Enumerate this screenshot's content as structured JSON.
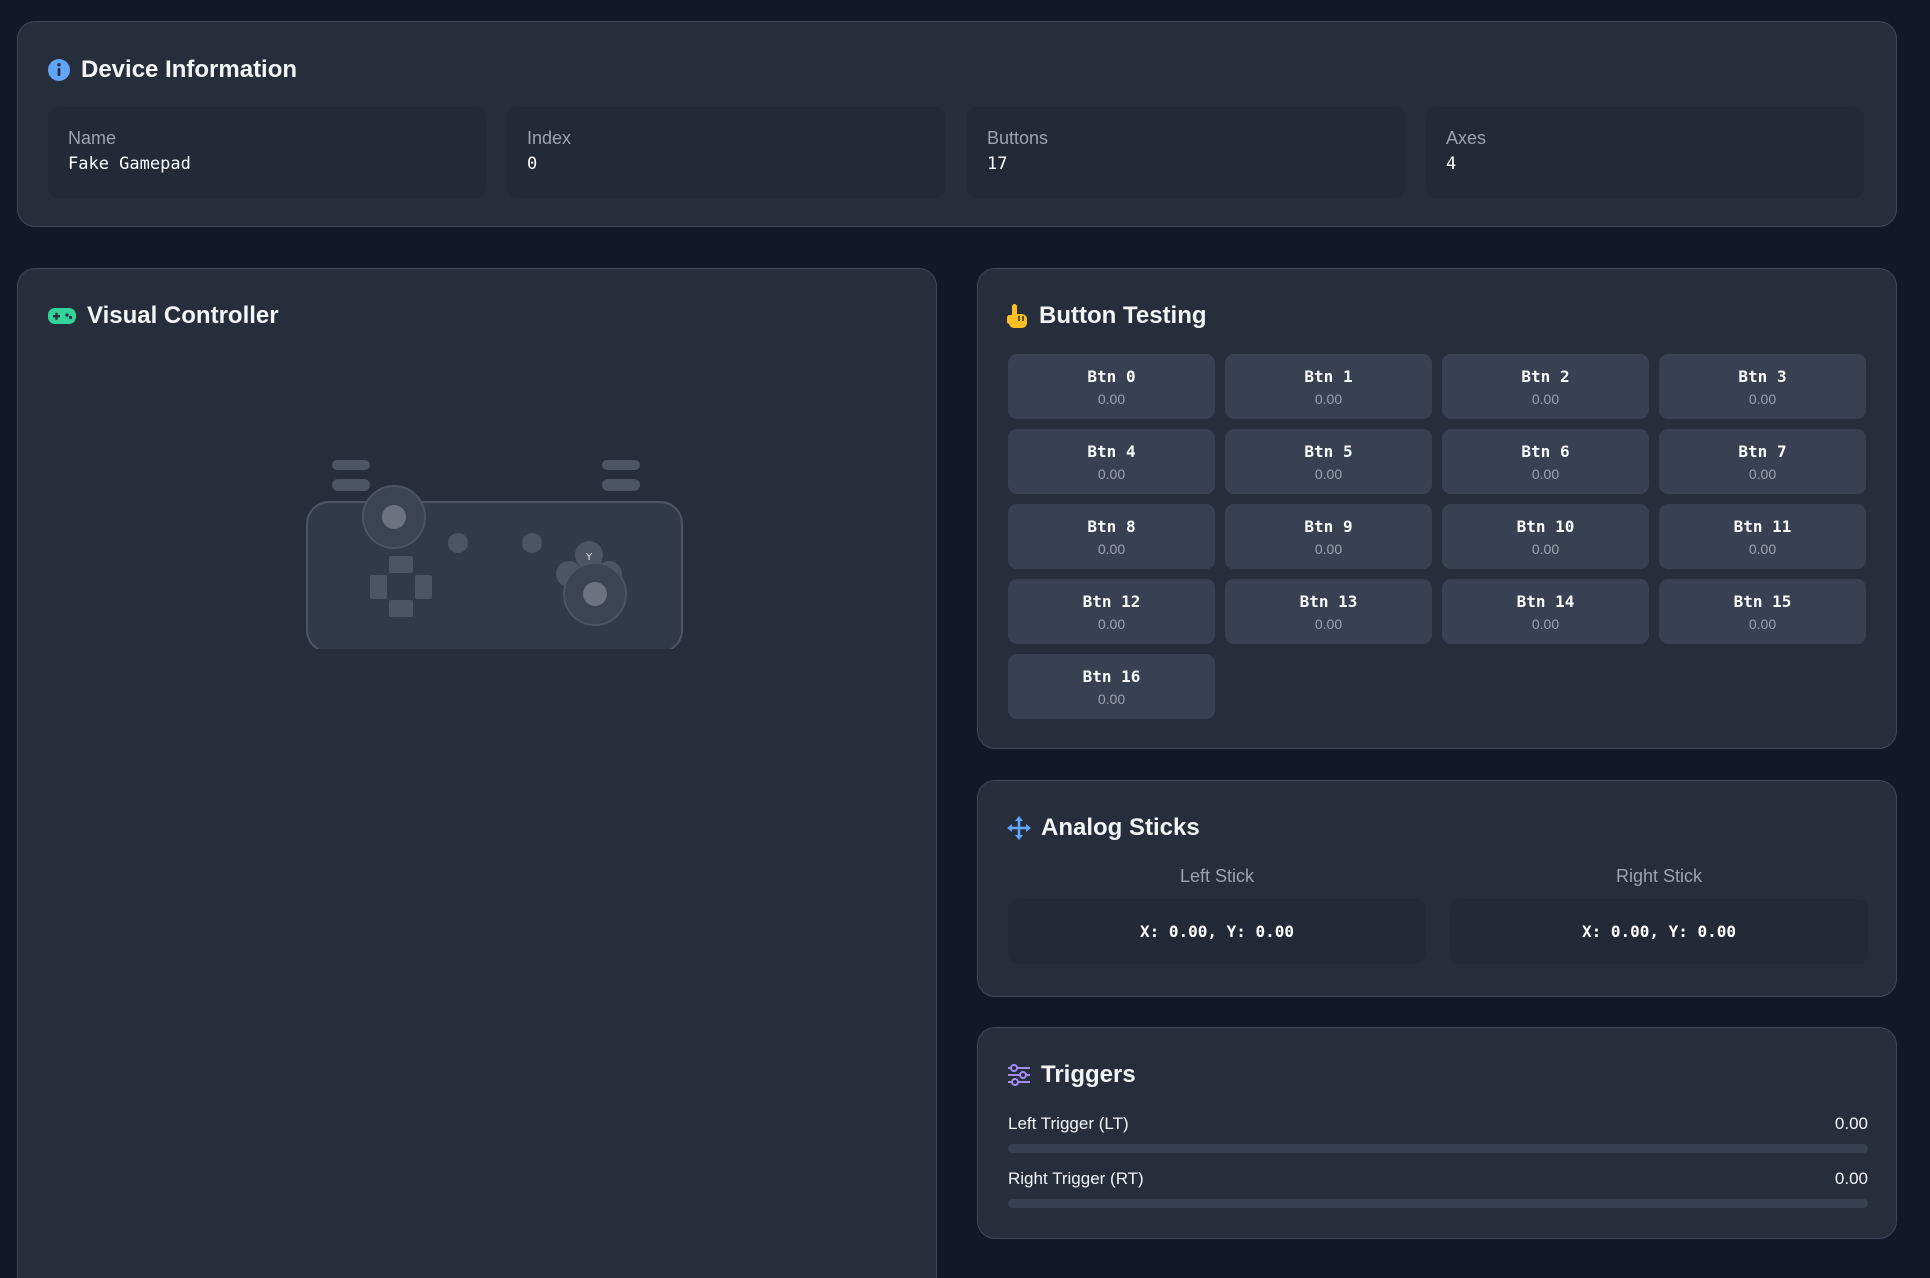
{
  "colors": {
    "background": "#111827",
    "card": "#262e3c",
    "info_icon": "#60a5fa",
    "controller_icon": "#34d399",
    "hand_icon": "#fbbf24",
    "move_icon": "#60a5fa",
    "sliders_icon": "#a78bfa"
  },
  "device_info": {
    "title": "Device Information",
    "icon": "info-circle-icon",
    "fields": [
      {
        "label": "Name",
        "value": "Fake Gamepad"
      },
      {
        "label": "Index",
        "value": "0"
      },
      {
        "label": "Buttons",
        "value": "17"
      },
      {
        "label": "Axes",
        "value": "4"
      }
    ]
  },
  "visual_controller": {
    "title": "Visual Controller",
    "icon": "gamepad-icon",
    "face_button_label": "Y"
  },
  "button_testing": {
    "title": "Button Testing",
    "icon": "pointing-hand-icon",
    "buttons": [
      {
        "label": "Btn 0",
        "value": "0.00"
      },
      {
        "label": "Btn 1",
        "value": "0.00"
      },
      {
        "label": "Btn 2",
        "value": "0.00"
      },
      {
        "label": "Btn 3",
        "value": "0.00"
      },
      {
        "label": "Btn 4",
        "value": "0.00"
      },
      {
        "label": "Btn 5",
        "value": "0.00"
      },
      {
        "label": "Btn 6",
        "value": "0.00"
      },
      {
        "label": "Btn 7",
        "value": "0.00"
      },
      {
        "label": "Btn 8",
        "value": "0.00"
      },
      {
        "label": "Btn 9",
        "value": "0.00"
      },
      {
        "label": "Btn 10",
        "value": "0.00"
      },
      {
        "label": "Btn 11",
        "value": "0.00"
      },
      {
        "label": "Btn 12",
        "value": "0.00"
      },
      {
        "label": "Btn 13",
        "value": "0.00"
      },
      {
        "label": "Btn 14",
        "value": "0.00"
      },
      {
        "label": "Btn 15",
        "value": "0.00"
      },
      {
        "label": "Btn 16",
        "value": "0.00"
      }
    ]
  },
  "analog_sticks": {
    "title": "Analog Sticks",
    "icon": "move-arrows-icon",
    "left": {
      "label": "Left Stick",
      "value": "X: 0.00, Y: 0.00"
    },
    "right": {
      "label": "Right Stick",
      "value": "X: 0.00, Y: 0.00"
    }
  },
  "triggers": {
    "title": "Triggers",
    "icon": "sliders-icon",
    "items": [
      {
        "label": "Left Trigger (LT)",
        "value": "0.00",
        "level": 0
      },
      {
        "label": "Right Trigger (RT)",
        "value": "0.00",
        "level": 0
      }
    ]
  }
}
